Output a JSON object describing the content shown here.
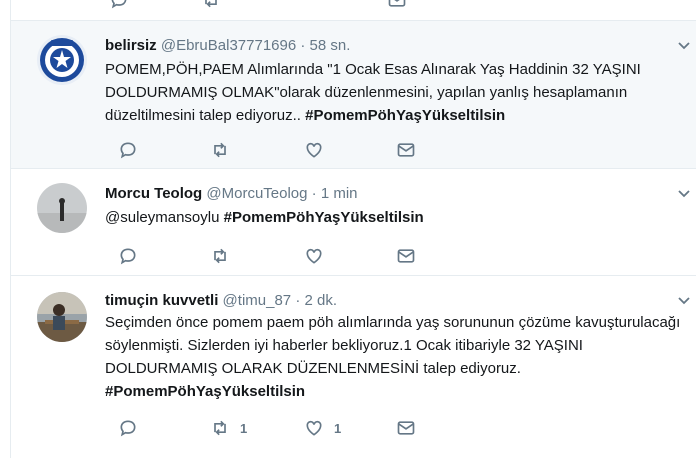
{
  "tweets": [
    {
      "name": "belirsiz",
      "handle": "@EbruBal37771696",
      "sep": "·",
      "time": "58 sn.",
      "text": "POMEM,PÖH,PAEM Alımlarında \"1 Ocak Esas Alınarak Yaş Haddinin 32 YAŞINI DOLDURMAMIŞ OLMAK\"olarak düzenlenmesini, yapılan yanlış hesaplamanın düzeltilmesini talep ediyoruz..",
      "hashtag": "#PomemPöhYaşYükseltilsin"
    },
    {
      "name": "Morcu Teolog",
      "handle": "@MorcuTeolog",
      "sep": "·",
      "time": "1 min",
      "text": "@suleymansoylu",
      "hashtag": "#PomemPöhYaşYükseltilsin"
    },
    {
      "name": "timuçin kuvvetli",
      "handle": "@timu_87",
      "sep": "·",
      "time": "2 dk.",
      "text": "Seçimden önce pomem paem pöh alımlarında yaş sorununun çözüme kavuşturulacağı söylenmişti. Sizlerden iyi haberler bekliyoruz.1 Ocak itibariyle 32 YAŞINI DOLDURMAMIŞ OLARAK DÜZENLENMESİNİ talep ediyoruz.",
      "hashtag": "#PomemPöhYaşYükseltilsin",
      "retweets": "1",
      "likes": "1"
    }
  ],
  "icons": {
    "reply": "reply-icon",
    "retweet": "retweet-icon",
    "like": "heart-icon",
    "dm": "envelope-icon",
    "menu": "chevron-down-icon"
  },
  "colors": {
    "text": "#14171a",
    "muted": "#657786",
    "highlight_bg": "#f5f8fa",
    "border": "#e6ecf0"
  }
}
